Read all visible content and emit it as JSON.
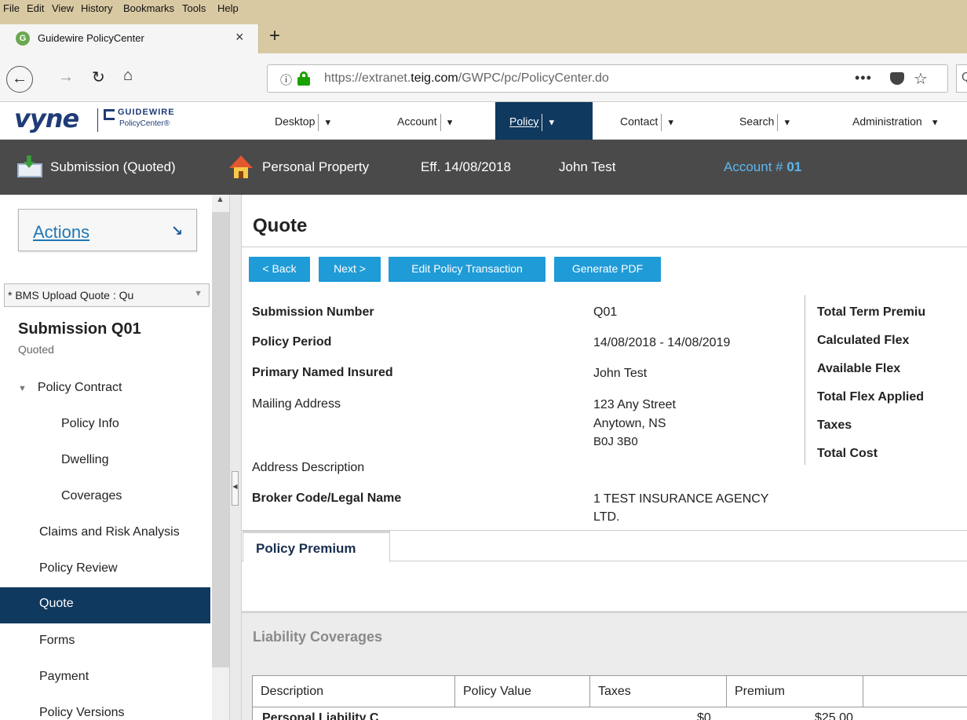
{
  "browser": {
    "menu": [
      "File",
      "Edit",
      "View",
      "History",
      "Bookmarks",
      "Tools",
      "Help"
    ],
    "tab_favicon": "G",
    "tab_title": "Guidewire PolicyCenter",
    "tab_close": "×",
    "new_tab": "+",
    "url_prefix": "https://extranet.",
    "url_domain": "teig.com",
    "url_path": "/GWPC/pc/PolicyCenter.do",
    "url_more": "•••",
    "search_edge": "Q"
  },
  "app": {
    "logo_text": "vyne",
    "logo_guidewire": "GUIDEWIRE",
    "logo_policycenter": "PolicyCenter®",
    "nav": [
      {
        "label": "Desktop",
        "active": false
      },
      {
        "label": "Account",
        "active": false
      },
      {
        "label": "Policy",
        "active": true
      },
      {
        "label": "Contact",
        "active": false
      },
      {
        "label": "Search",
        "active": false
      },
      {
        "label": "Administration",
        "active": false
      }
    ],
    "active_color": "#10395f",
    "accent_color": "#1f9bd7"
  },
  "infobar": {
    "submission": "Submission (Quoted)",
    "product": "Personal Property",
    "effective": "Eff. 14/08/2018",
    "insured": "John Test",
    "account_label": "Account #",
    "account_number": "01"
  },
  "sidebar": {
    "actions_label": "Actions",
    "actions_arrow": "↘",
    "quote_dropdown": "* BMS Upload Quote : Qu",
    "submission_title": "Submission Q01",
    "submission_status": "Quoted",
    "items": [
      {
        "label": "Policy Contract",
        "indent": 0,
        "collapsible": true
      },
      {
        "label": "Policy Info",
        "indent": 1
      },
      {
        "label": "Dwelling",
        "indent": 1
      },
      {
        "label": "Coverages",
        "indent": 1
      },
      {
        "label": "Claims and Risk Analysis",
        "indent": 0
      },
      {
        "label": "Policy Review",
        "indent": 0
      },
      {
        "label": "Quote",
        "indent": 0,
        "selected": true
      },
      {
        "label": "Forms",
        "indent": 0
      },
      {
        "label": "Payment",
        "indent": 0
      },
      {
        "label": "Policy Versions",
        "indent": 0
      }
    ]
  },
  "main": {
    "title": "Quote",
    "buttons": {
      "back": "< Back",
      "next": "Next >",
      "edit": "Edit Policy Transaction",
      "pdf": "Generate PDF"
    },
    "fields": {
      "submission_number_label": "Submission Number",
      "submission_number": "Q01",
      "policy_period_label": "Policy Period",
      "policy_period": "14/08/2018 - 14/08/2019",
      "primary_insured_label": "Primary Named Insured",
      "primary_insured": "John Test",
      "mailing_address_label": "Mailing Address",
      "mailing_address_line1": "123 Any Street",
      "mailing_address_line2": "Anytown, NS",
      "mailing_address_line3": "B0J 3B0",
      "address_description_label": "Address Description",
      "broker_label": "Broker Code/Legal Name",
      "broker_line1": "1 TEST INSURANCE AGENCY",
      "broker_line2": "LTD."
    },
    "summary_labels": {
      "total_term_premium": "Total Term Premiu",
      "calculated_flex": "Calculated Flex",
      "available_flex": "Available Flex",
      "total_flex_applied": "Total Flex Applied",
      "taxes": "Taxes",
      "total_cost": "Total Cost"
    },
    "tab_premium": "Policy Premium",
    "section_title": "Liability Coverages",
    "table": {
      "headers": [
        "Description",
        "Policy Value",
        "Taxes",
        "Premium"
      ],
      "first_row": {
        "description": "Personal Liability C",
        "taxes": "$0",
        "premium": "$25.00"
      }
    }
  }
}
